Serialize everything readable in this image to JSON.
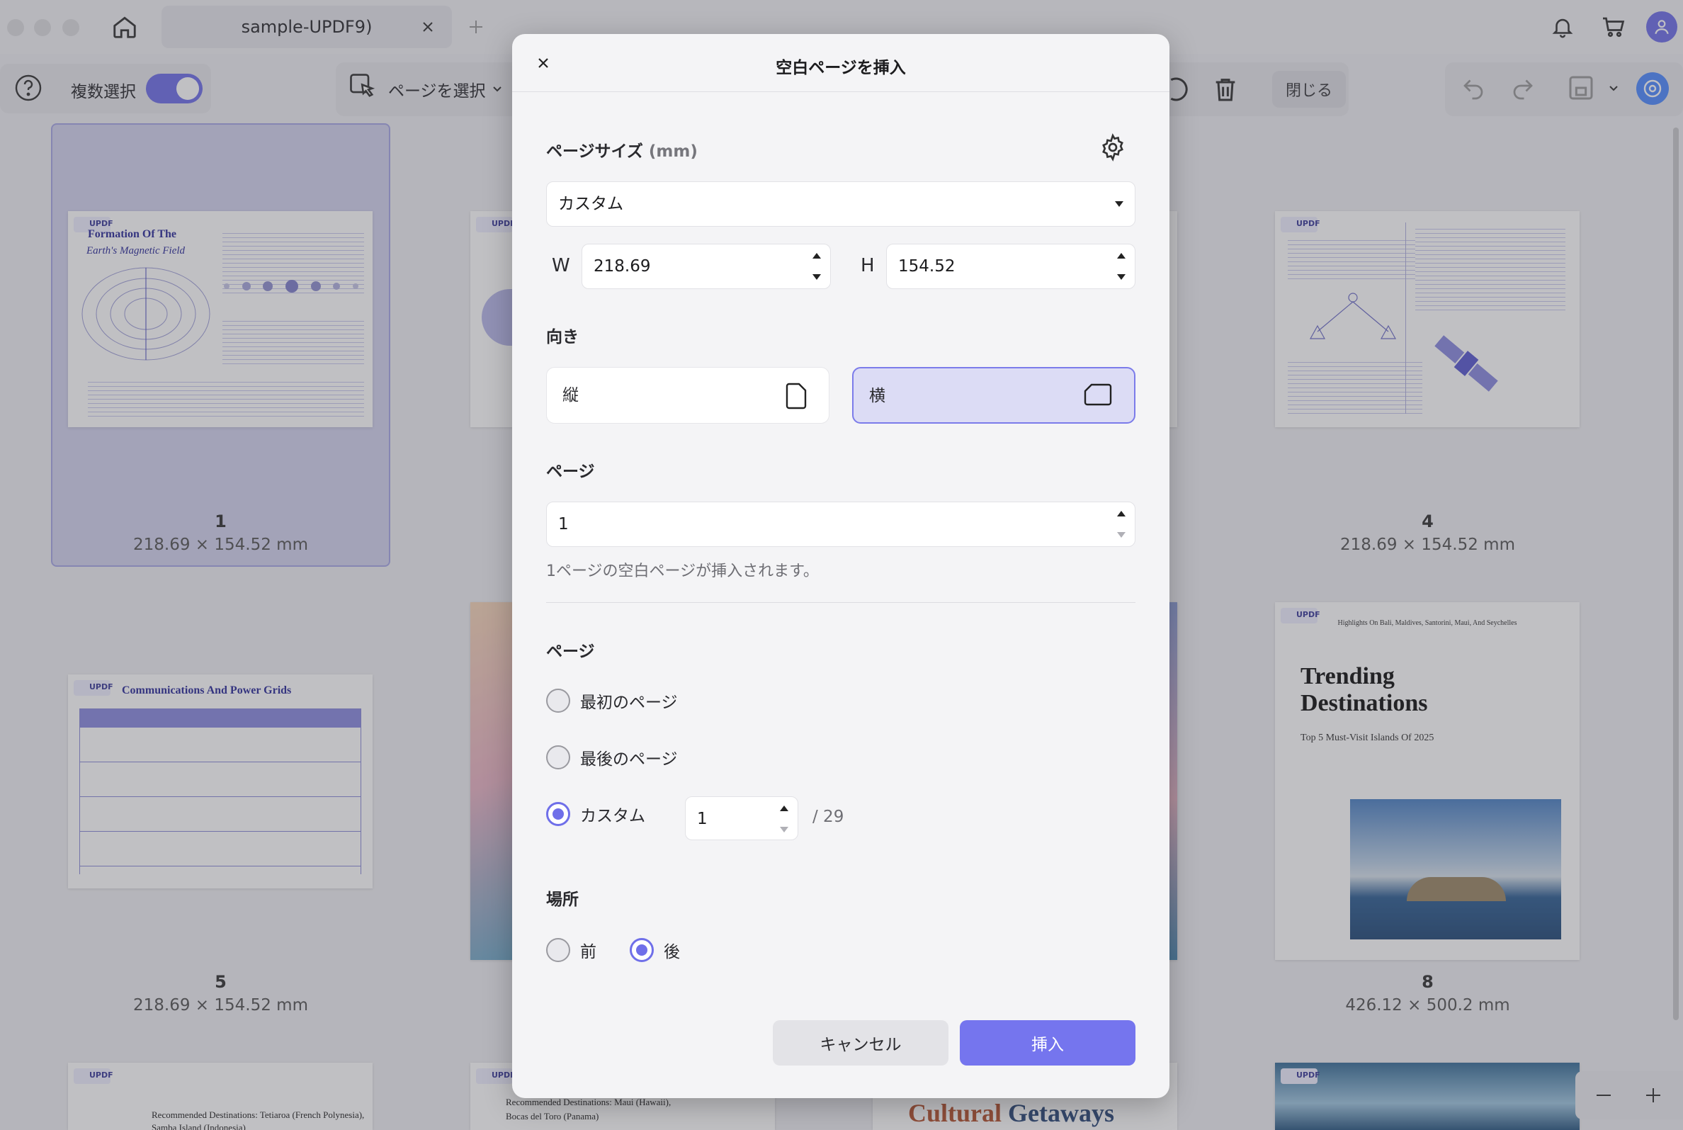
{
  "tab": {
    "title": "sample-UPDF9)"
  },
  "toolbar": {
    "multi_select_label": "複数選択",
    "select_pages_label": "ページを選択",
    "close_label": "閉じる"
  },
  "pages": [
    {
      "number": "1",
      "size": "218.69 × 154.52 mm",
      "title_line1": "Formation Of The",
      "title_line2": "Earth's Magnetic Field"
    },
    {
      "number": "4",
      "size": "218.69 × 154.52 mm"
    },
    {
      "number": "5",
      "size": "218.69 × 154.52 mm",
      "title": "Communications And Power Grids"
    },
    {
      "number": "8",
      "size": "426.12 × 500.2 mm",
      "title_line1": "Trending",
      "title_line2": "Destinations",
      "subtitle": "Top 5 Must-Visit Islands Of 2025",
      "header": "Highlights On Bali, Maldives, Santorini, Maui, And Seychelles"
    }
  ],
  "bottom_row": {
    "card_a": "Recommended Destinations: Tetiaroa (French Polynesia),",
    "card_a2": "Samba Island (Indonesia)",
    "card_b": "Recommended Destinations: Maui (Hawaii),",
    "card_b2": "Bocas del Toro (Panama)",
    "card_c_part1": "Cultural",
    "card_c_part2": "Getaways"
  },
  "badge": "UPDF",
  "dialog": {
    "title": "空白ページを挿入",
    "page_size_label": "ページサイズ",
    "page_size_unit": "(mm)",
    "preset_value": "カスタム",
    "width_label": "W",
    "width_value": "218.69",
    "height_label": "H",
    "height_value": "154.52",
    "orientation_label": "向き",
    "portrait_label": "縦",
    "landscape_label": "横",
    "pages_label": "ページ",
    "pages_value": "1",
    "hint": "1ページの空白ページが挿入されます。",
    "position_section_label": "ページ",
    "first_page_label": "最初のページ",
    "last_page_label": "最後のページ",
    "custom_label": "カスタム",
    "custom_value": "1",
    "total_pages": "/ 29",
    "location_label": "場所",
    "before_label": "前",
    "after_label": "後",
    "cancel_label": "キャンセル",
    "insert_label": "挿入"
  },
  "colors": {
    "accent": "#7575ee",
    "overlay": "rgba(70,70,80,0.34)"
  }
}
